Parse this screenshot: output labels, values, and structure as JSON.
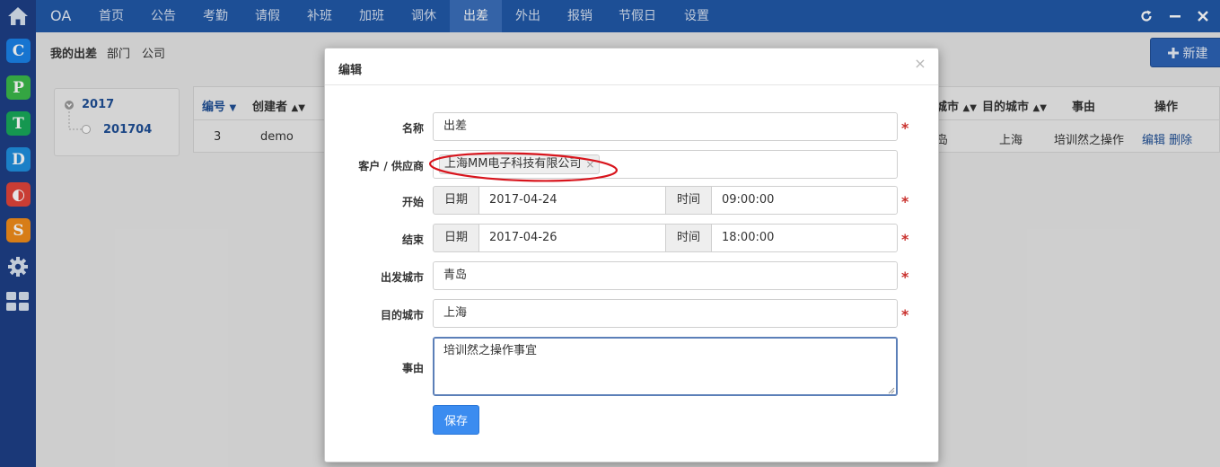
{
  "topnav": {
    "brand": "OA",
    "items": [
      "首页",
      "公告",
      "考勤",
      "请假",
      "补班",
      "加班",
      "调休",
      "出差",
      "外出",
      "报销",
      "节假日",
      "设置"
    ],
    "active": "出差"
  },
  "subnav": {
    "items": [
      "我的出差",
      "部门",
      "公司"
    ]
  },
  "new_button": {
    "label": "新建"
  },
  "tree": {
    "year": "2017",
    "month": "201704"
  },
  "grid": {
    "headers": {
      "id": "编号",
      "creator": "创建者",
      "from_city": "城市",
      "to_city": "目的城市",
      "reason": "事由",
      "actions": "操作"
    },
    "row": {
      "id": "3",
      "creator": "demo",
      "from_city": "岛",
      "to_city": "上海",
      "reason": "培训然之操作",
      "edit": "编辑",
      "delete": "删除"
    }
  },
  "apps": [
    {
      "letter": "C",
      "color": "#1a82e8"
    },
    {
      "letter": "P",
      "color": "#3ab84a"
    },
    {
      "letter": "T",
      "color": "#18a95a"
    },
    {
      "letter": "D",
      "color": "#1f8fde"
    },
    {
      "letter": "◐",
      "color": "#e0453a"
    },
    {
      "letter": "S",
      "color": "#f08c1a"
    }
  ],
  "modal": {
    "title": "编辑",
    "close": "×",
    "fields": {
      "name": {
        "label": "名称",
        "value": "出差"
      },
      "customer": {
        "label": "客户 / 供应商",
        "tag": "上海MM电子科技有限公司",
        "tag_remove": "×"
      },
      "start": {
        "label": "开始",
        "date_label": "日期",
        "date": "2017-04-24",
        "time_label": "时间",
        "time": "09:00:00"
      },
      "end": {
        "label": "结束",
        "date_label": "日期",
        "date": "2017-04-26",
        "time_label": "时间",
        "time": "18:00:00"
      },
      "from_city": {
        "label": "出发城市",
        "value": "青岛"
      },
      "to_city": {
        "label": "目的城市",
        "value": "上海"
      },
      "reason": {
        "label": "事由",
        "value": "培训然之操作事宜"
      }
    },
    "required_mark": "*",
    "save_label": "保存"
  },
  "colors": {
    "topbar": "#2158a8",
    "sidebar": "#1e3f86",
    "primary": "#3b8cf0",
    "required": "#c9302c",
    "annotation": "#d8141c"
  }
}
